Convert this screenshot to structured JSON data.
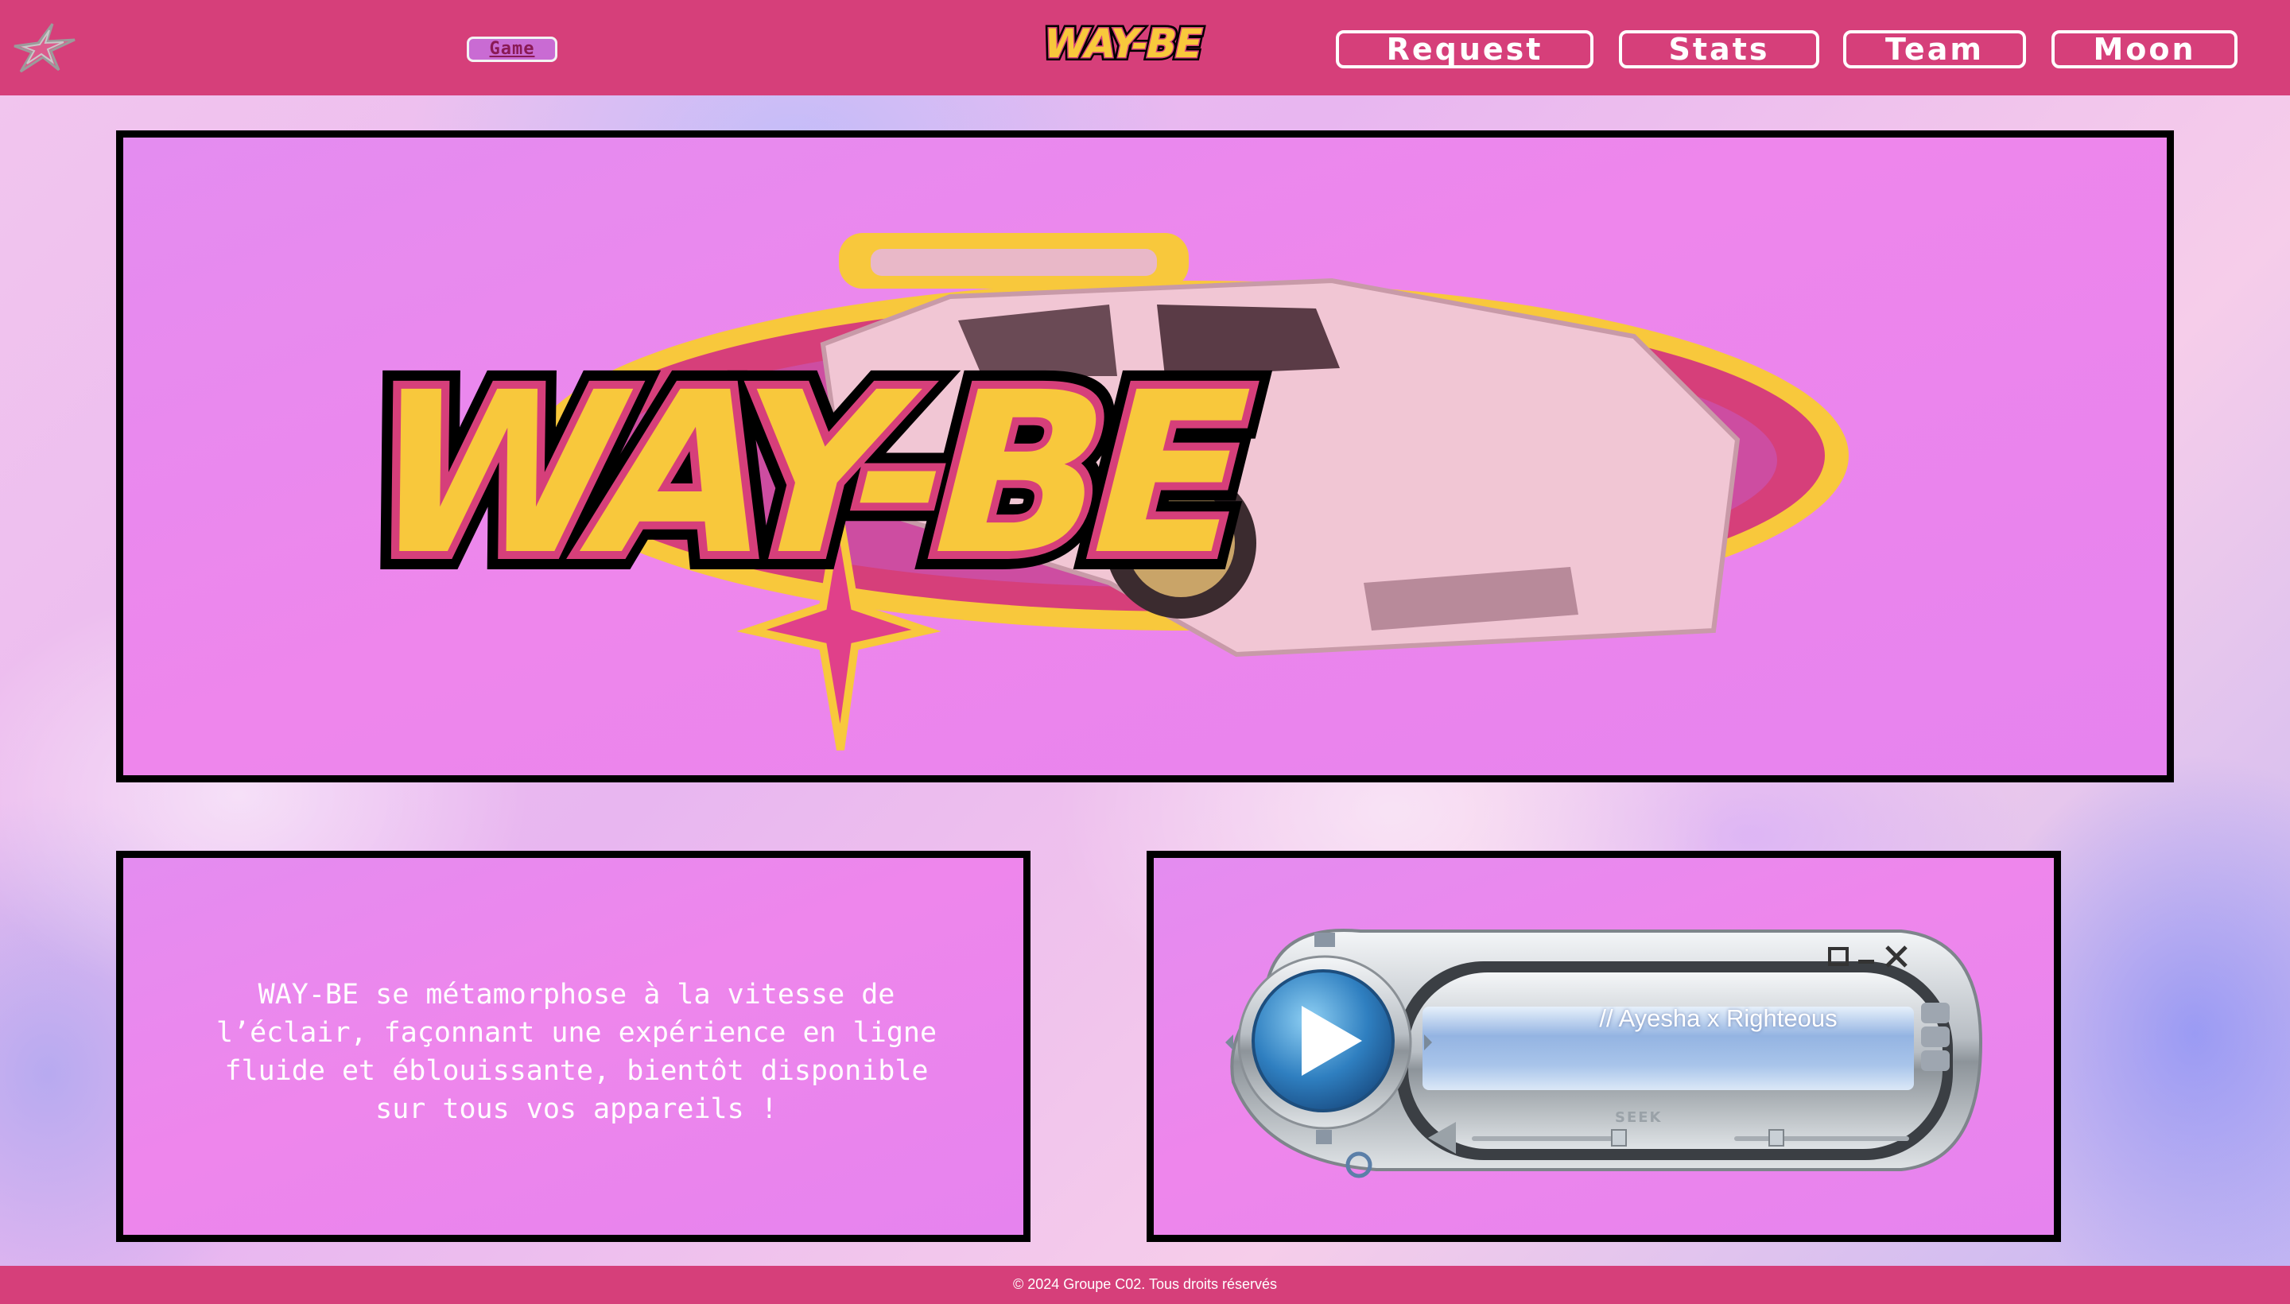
{
  "header": {
    "game_label": "Game",
    "brand_text": "WAY-BE",
    "nav": [
      "Request",
      "Stats",
      "Team",
      "Moon"
    ]
  },
  "hero": {
    "brand_text": "WAY-BE"
  },
  "description": {
    "text": "WAY-BE se métamorphose à la vitesse de l’éclair, façonnant une expérience en ligne fluide et éblouissante, bientôt disponible sur tous vos appareils !"
  },
  "player": {
    "track": "// Ayesha x Righteous",
    "seek_label": "SEEK",
    "play_icon": "play-icon"
  },
  "footer": {
    "text": "© 2024 Groupe C02. Tous droits réservés"
  },
  "colors": {
    "header_bg": "#d63f7a",
    "panel_bg": "#e98aee",
    "logo_yellow": "#f8c83c",
    "logo_pink": "#d63f7a",
    "border": "#000000"
  }
}
